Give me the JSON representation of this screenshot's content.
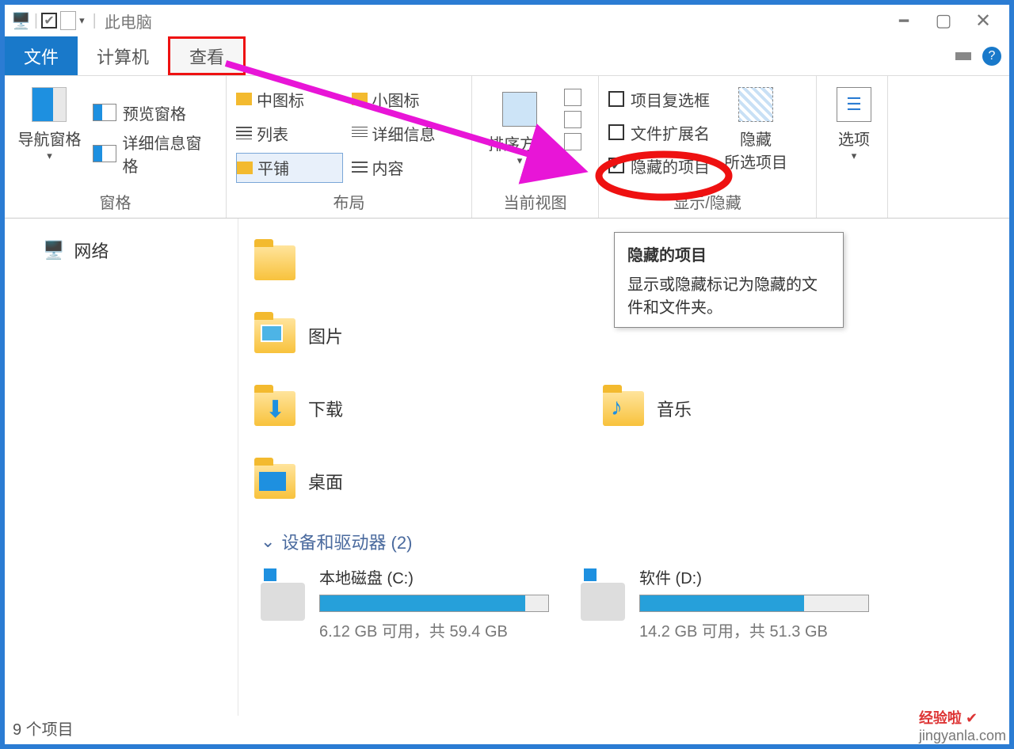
{
  "window": {
    "title": "此电脑"
  },
  "tabs": {
    "file": "文件",
    "computer": "计算机",
    "view": "查看"
  },
  "ribbon": {
    "panes": {
      "nav": "导航窗格",
      "preview": "预览窗格",
      "details": "详细信息窗格",
      "caption": "窗格"
    },
    "layout": {
      "medium": "中图标",
      "small": "小图标",
      "list": "列表",
      "details": "详细信息",
      "tiles": "平铺",
      "content": "内容",
      "caption": "布局"
    },
    "currentview": {
      "sort": "排序方式",
      "caption": "当前视图"
    },
    "showhide": {
      "checkboxes": "项目复选框",
      "extensions": "文件扩展名",
      "hidden": "隐藏的项目",
      "hide_btn": "隐藏",
      "hide_btn2": "所选项目",
      "caption": "显示/隐藏"
    },
    "options": "选项"
  },
  "tooltip": {
    "title": "隐藏的项目",
    "body": "显示或隐藏标记为隐藏的文件和文件夹。"
  },
  "nav": {
    "network": "网络"
  },
  "folders": {
    "pictures": "图片",
    "downloads": "下载",
    "desktop": "桌面",
    "music": "音乐"
  },
  "section": {
    "devices": "设备和驱动器 (2)"
  },
  "drives": {
    "c": {
      "label": "本地磁盘 (C:)",
      "free": "6.12 GB 可用，共 59.4 GB",
      "pct": 90
    },
    "d": {
      "label": "软件 (D:)",
      "free": "14.2 GB 可用，共 51.3 GB",
      "pct": 72
    }
  },
  "status": "9 个项目",
  "watermark": {
    "a": "经验啦",
    "b": "jingyanla.com"
  }
}
